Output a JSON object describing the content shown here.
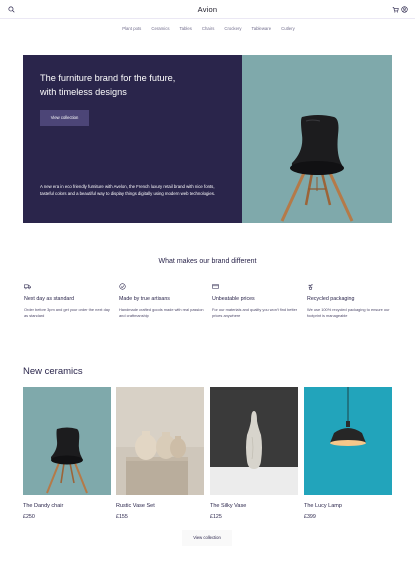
{
  "header": {
    "brand": "Avion",
    "icons": [
      "search-icon",
      "cart-icon",
      "user-icon"
    ]
  },
  "nav": {
    "items": [
      "Plant pots",
      "Ceramics",
      "Tables",
      "Chairs",
      "Crockery",
      "Tableware",
      "Cutlery"
    ]
  },
  "hero": {
    "title": "The furniture brand for the future, with timeless designs",
    "button_label": "View collection",
    "description": "A new era in eco friendly furniture with Avelon, the French luxury retail brand with nice fonts, tasteful colors and a beautiful way to display things digitally using modern web technologies."
  },
  "features": {
    "title": "What makes our brand different",
    "items": [
      {
        "icon": "delivery-truck-icon",
        "title": "Next day as standard",
        "text": "Order before 3pm and get your order the next day as standard"
      },
      {
        "icon": "checkmark-circle-icon",
        "title": "Made by true artisans",
        "text": "Handmade crafted goods made with real passion and craftmanship"
      },
      {
        "icon": "credit-card-icon",
        "title": "Unbeatable prices",
        "text": "For our materials and quality you won't find better prices anywhere"
      },
      {
        "icon": "plant-pot-icon",
        "title": "Recycled packaging",
        "text": "We use 100% recycled packaging to ensure our footprint is manageable"
      }
    ]
  },
  "ceramics": {
    "title": "New ceramics",
    "products": [
      {
        "name": "The Dandy chair",
        "price": "£250"
      },
      {
        "name": "Rustic Vase Set",
        "price": "£155"
      },
      {
        "name": "The Silky Vase",
        "price": "£125"
      },
      {
        "name": "The Lucy Lamp",
        "price": "£399"
      }
    ],
    "button_label": "View collection"
  },
  "colors": {
    "primary": "#2a254b",
    "button": "#4c4577",
    "hero_image_bg": "#7fa9ab",
    "lamp_bg": "#22a4bb"
  }
}
